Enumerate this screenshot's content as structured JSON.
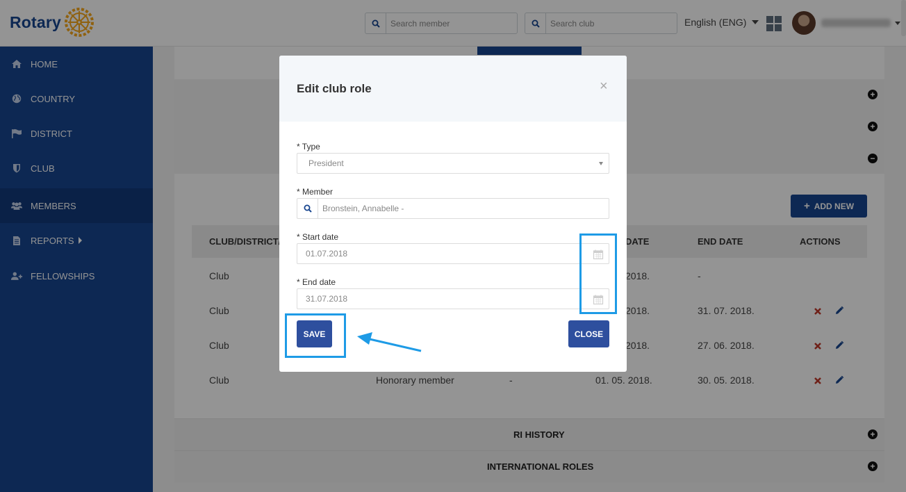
{
  "header": {
    "logo_text": "Rotary",
    "search_member_placeholder": "Search member",
    "search_club_placeholder": "Search club",
    "language": "English (ENG)",
    "username": "[blurred]"
  },
  "sidebar": {
    "items": [
      {
        "label": "HOME",
        "icon": "home-icon"
      },
      {
        "label": "COUNTRY",
        "icon": "globe-icon"
      },
      {
        "label": "DISTRICT",
        "icon": "flag-icon"
      },
      {
        "label": "CLUB",
        "icon": "shield-icon"
      },
      {
        "label": "MEMBERS",
        "icon": "users-icon",
        "active": true
      },
      {
        "label": "REPORTS",
        "icon": "document-icon",
        "has_submenu": true
      },
      {
        "label": "FELLOWSHIPS",
        "icon": "user-plus-icon"
      }
    ]
  },
  "content": {
    "add_new_label": "ADD NEW",
    "table": {
      "headers": [
        "CLUB/DISTRICT/C",
        "DATE",
        "END DATE",
        "ACTIONS"
      ],
      "rows": [
        {
          "type": "Club",
          "role": "",
          "extra": "",
          "start": "2018.",
          "end": "-",
          "actions": false
        },
        {
          "type": "Club",
          "role": "",
          "extra": "",
          "start": "2018.",
          "end": "31. 07. 2018.",
          "actions": true
        },
        {
          "type": "Club",
          "role": "",
          "extra": "",
          "start": "2018.",
          "end": "27. 06. 2018.",
          "actions": true
        },
        {
          "type": "Club",
          "role": "Honorary member",
          "extra": "-",
          "start": "01. 05. 2018.",
          "end": "30. 05. 2018.",
          "actions": true
        }
      ]
    },
    "sections": [
      "RI HISTORY",
      "INTERNATIONAL ROLES"
    ]
  },
  "modal": {
    "title": "Edit club role",
    "close_symbol": "×",
    "type_label": "* Type",
    "type_value": "President",
    "member_label": "* Member",
    "member_value": "Bronstein, Annabelle -",
    "start_label": "* Start date",
    "start_value": "01.07.2018",
    "end_label": "* End date",
    "end_value": "31.07.2018",
    "save_label": "SAVE",
    "close_label": "CLOSE"
  },
  "colors": {
    "brand_blue": "#17458f",
    "button_blue": "#2e4f9e",
    "highlight": "#1e9be6",
    "delete_red": "#c0392b"
  }
}
